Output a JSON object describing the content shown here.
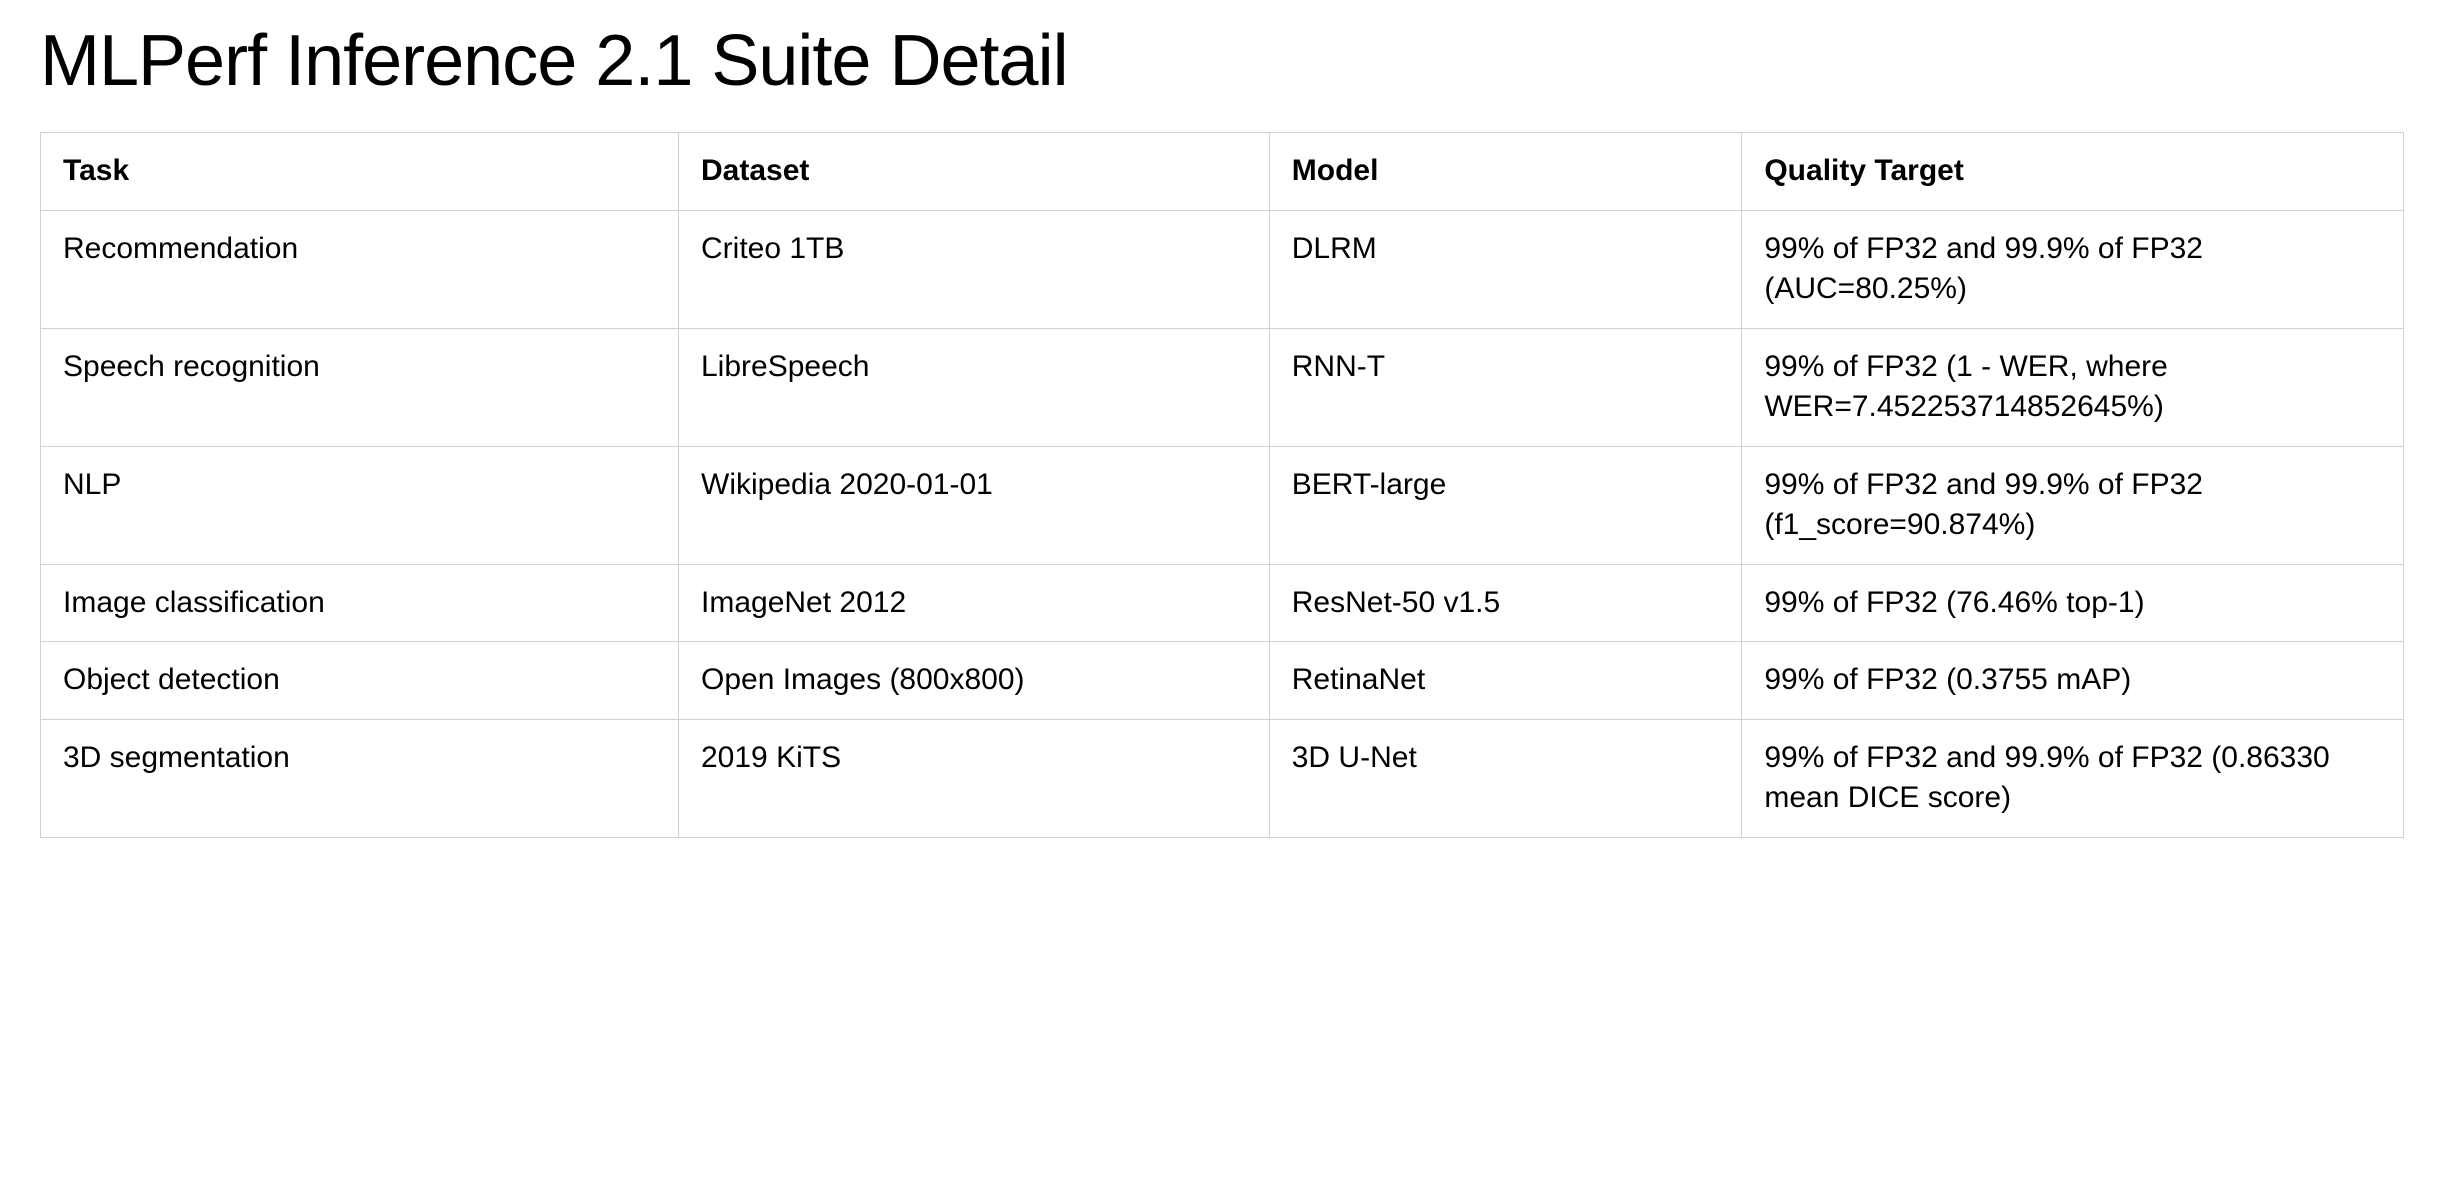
{
  "title": "MLPerf Inference 2.1 Suite Detail",
  "chart_data": {
    "type": "table",
    "headers": [
      "Task",
      "Dataset",
      "Model",
      "Quality Target"
    ],
    "rows": [
      {
        "task": "Recommendation",
        "dataset": "Criteo 1TB",
        "model": "DLRM",
        "quality": "99% of FP32 and 99.9% of FP32 (AUC=80.25%)"
      },
      {
        "task": "Speech recognition",
        "dataset": "LibreSpeech",
        "model": "RNN-T",
        "quality": "99% of FP32 (1 - WER, where WER=7.452253714852645%)"
      },
      {
        "task": "NLP",
        "dataset": "Wikipedia 2020-01-01",
        "model": "BERT-large",
        "quality": "99% of FP32 and 99.9% of FP32 (f1_score=90.874%)"
      },
      {
        "task": "Image classification",
        "dataset": "ImageNet 2012",
        "model": "ResNet-50 v1.5",
        "quality": "99% of FP32 (76.46% top-1)"
      },
      {
        "task": "Object detection",
        "dataset": "Open Images (800x800)",
        "model": "RetinaNet",
        "quality": "99% of FP32 (0.3755 mAP)"
      },
      {
        "task": "3D segmentation",
        "dataset": "2019 KiTS",
        "model": "3D U-Net",
        "quality": "99% of FP32 and 99.9% of FP32 (0.86330 mean DICE score)"
      }
    ]
  }
}
